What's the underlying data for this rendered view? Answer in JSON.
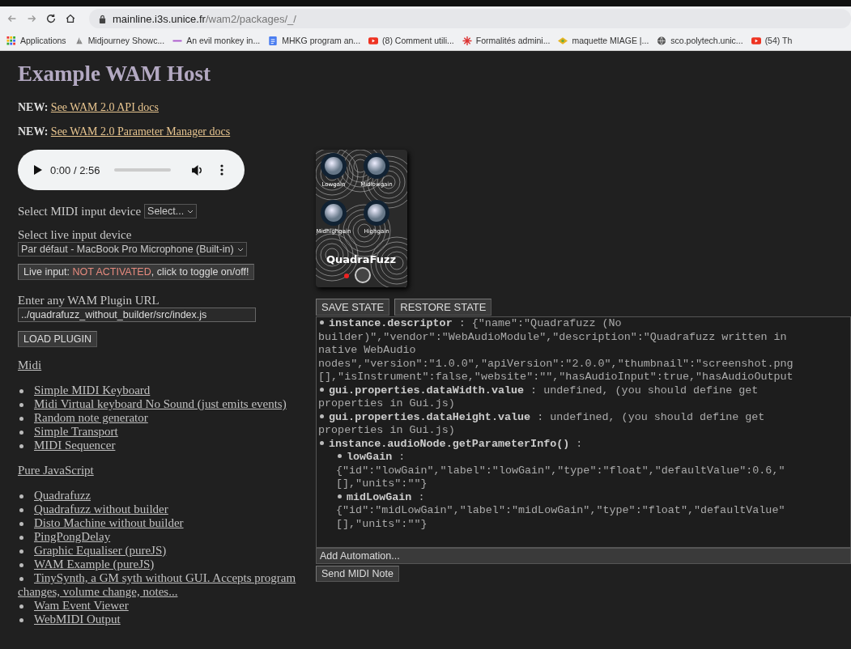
{
  "browser": {
    "url_host": "mainline.i3s.unice.fr",
    "url_path": "/wam2/packages/_/",
    "bookmarks": [
      {
        "kind": "apps",
        "label": "Applications"
      },
      {
        "kind": "sail",
        "label": "Midjourney Showc..."
      },
      {
        "kind": "line",
        "label": "An evil monkey in..."
      },
      {
        "kind": "doc",
        "label": "MHKG program an..."
      },
      {
        "kind": "video",
        "label": "(8) Comment utili..."
      },
      {
        "kind": "cross",
        "label": "Formalités admini..."
      },
      {
        "kind": "eye",
        "label": "maquette MIAGE |..."
      },
      {
        "kind": "globe",
        "label": "sco.polytech.unic..."
      },
      {
        "kind": "video",
        "label": "(54) Th"
      }
    ]
  },
  "page": {
    "title": "Example WAM Host",
    "news": [
      {
        "label": "NEW:",
        "link": "See WAM 2.0 API docs"
      },
      {
        "label": "NEW:",
        "link": "See WAM 2.0 Parameter Manager docs"
      }
    ],
    "audio_player": {
      "time": "0:00 / 2:56",
      "level": 0
    },
    "midi_select": {
      "label": "Select MIDI input device",
      "value": "Select..."
    },
    "live_select": {
      "label": "Select live input device",
      "value": "Par défaut - MacBook Pro Microphone (Built-in)"
    },
    "live_toggle": {
      "prefix": "Live input: ",
      "status": "NOT ACTIVATED",
      "suffix": ", click to toggle on/off!",
      "on": false
    },
    "plugin_url": {
      "label": "Enter any WAM Plugin URL",
      "value": "../quadrafuzz_without_builder/src/index.js"
    },
    "load_button": "LOAD PLUGIN",
    "sections": [
      {
        "heading": "Midi",
        "items": [
          "Simple MIDI Keyboard",
          "Midi Virtual keyboard No Sound (just emits events)",
          "Random note generator",
          "Simple Transport",
          "MIDI Sequencer"
        ]
      },
      {
        "heading": "Pure JavaScript",
        "items": [
          "Quadrafuzz",
          "Quadrafuzz without builder",
          "Disto Machine without builder",
          "PingPongDelay",
          "Graphic Equaliser (pureJS)",
          "WAM Example (pureJS)",
          "TinySynth, a GM syth without GUI. Accepts program changes, volume change, notes...",
          "Wam Event Viewer",
          "WebMIDI Output"
        ]
      }
    ]
  },
  "plugin": {
    "name": "QuadraFuzz",
    "knobs": [
      "Lowgain",
      "Midlowgain",
      "Midhighgain",
      "Highgain"
    ]
  },
  "state_buttons": [
    "SAVE STATE",
    "RESTORE STATE"
  ],
  "info": [
    {
      "kind": "bullet",
      "key": "instance.descriptor",
      "lines": [
        " : {\"name\":\"Quadrafuzz (No",
        "builder)\",\"vendor\":\"WebAudioModule\",\"description\":\"Quadrafuzz written in",
        "native WebAudio",
        "nodes\",\"version\":\"1.0.0\",\"apiVersion\":\"2.0.0\",\"thumbnail\":\"screenshot.png",
        "[],\"isInstrument\":false,\"website\":\"\",\"hasAudioInput\":true,\"hasAudioOutput"
      ]
    },
    {
      "kind": "bullet",
      "key": "gui.properties.dataWidth.value",
      "lines": [
        " : undefined, (you should define get",
        "properties in Gui.js)"
      ]
    },
    {
      "kind": "bullet",
      "key": "gui.properties.dataHeight.value",
      "lines": [
        " : undefined, (you should define get",
        "properties in Gui.js)"
      ]
    },
    {
      "kind": "bullet",
      "key": "instance.audioNode.getParameterInfo()",
      "lines": [
        " :"
      ]
    },
    {
      "kind": "param",
      "key": "lowGain",
      "lines": [
        " :",
        "{\"id\":\"lowGain\",\"label\":\"lowGain\",\"type\":\"float\",\"defaultValue\":0.6,\"",
        "[],\"units\":\"\"}"
      ]
    },
    {
      "kind": "param",
      "key": "midLowGain",
      "lines": [
        " :",
        "{\"id\":\"midLowGain\",\"label\":\"midLowGain\",\"type\":\"float\",\"defaultValue\"",
        "[],\"units\":\"\"}"
      ]
    }
  ],
  "automation": "Add Automation...",
  "midi_note_button": "Send MIDI Note"
}
